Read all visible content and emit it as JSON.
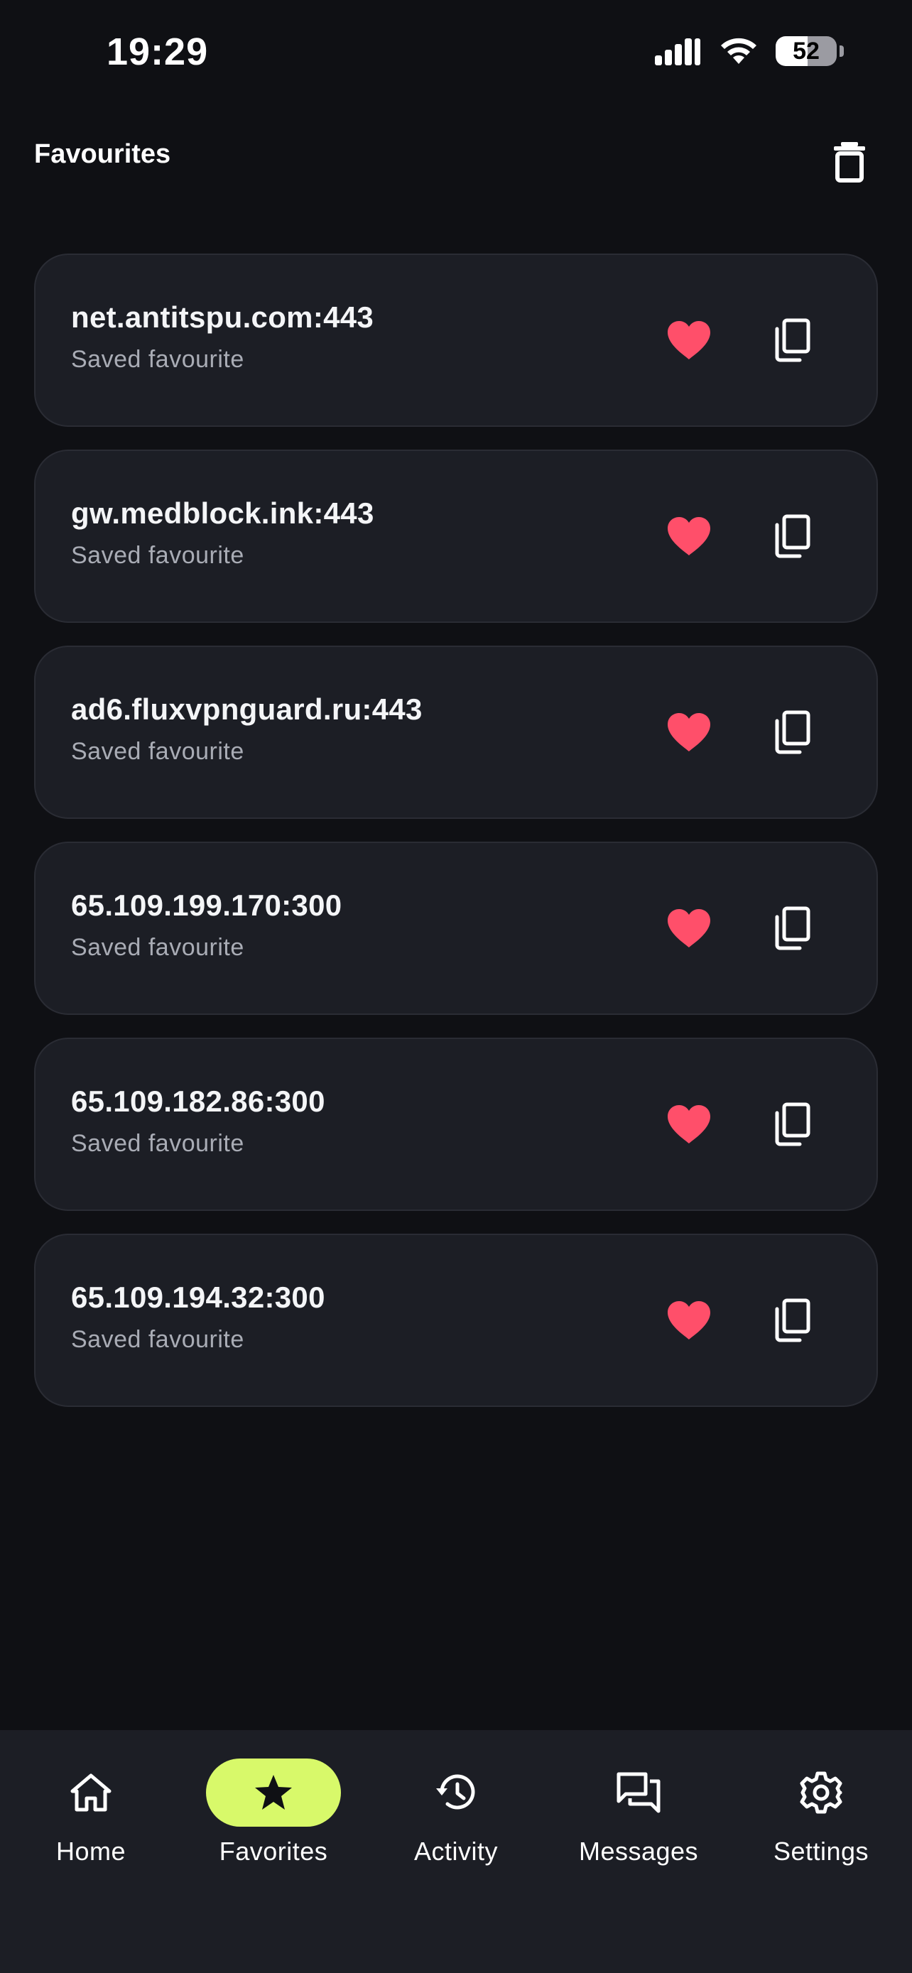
{
  "status_bar": {
    "time": "19:29",
    "battery_level": "52",
    "battery_fraction": 0.52
  },
  "header": {
    "title": "Favourites",
    "delete_icon": "trash-icon"
  },
  "favourites": [
    {
      "host": "net.antitspu.com:443",
      "subtitle": "Saved favourite"
    },
    {
      "host": "gw.medblock.ink:443",
      "subtitle": "Saved favourite"
    },
    {
      "host": "ad6.fluxvpnguard.ru:443",
      "subtitle": "Saved favourite"
    },
    {
      "host": "65.109.199.170:300",
      "subtitle": "Saved favourite"
    },
    {
      "host": "65.109.182.86:300",
      "subtitle": "Saved favourite"
    },
    {
      "host": "65.109.194.32:300",
      "subtitle": "Saved favourite"
    }
  ],
  "bottom_nav": {
    "items": [
      {
        "label": "Home",
        "icon": "home-icon",
        "active": false
      },
      {
        "label": "Favorites",
        "icon": "star-icon",
        "active": true
      },
      {
        "label": "Activity",
        "icon": "history-icon",
        "active": false
      },
      {
        "label": "Messages",
        "icon": "messages-icon",
        "active": false
      },
      {
        "label": "Settings",
        "icon": "gear-icon",
        "active": false
      }
    ]
  },
  "colors": {
    "background": "#0f1014",
    "card": "#1c1e25",
    "heart": "#ff4f6a",
    "accent": "#d8f96a"
  }
}
